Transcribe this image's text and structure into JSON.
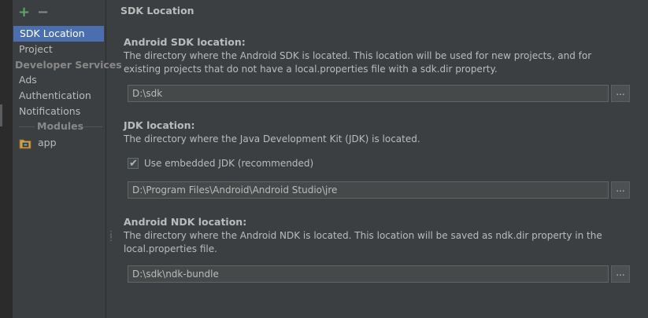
{
  "sidebar": {
    "add_glyph": "+",
    "remove_glyph": "−",
    "items": [
      {
        "label": "SDK Location",
        "selected": true
      },
      {
        "label": "Project"
      },
      {
        "label": "Developer Services",
        "header": true
      },
      {
        "label": "Ads"
      },
      {
        "label": "Authentication"
      },
      {
        "label": "Notifications"
      }
    ],
    "modules_header": "Modules",
    "modules": [
      {
        "label": "app",
        "icon": "module-folder-icon"
      }
    ]
  },
  "main": {
    "title": "SDK Location",
    "android_sdk": {
      "heading": "Android SDK location:",
      "description": "The directory where the Android SDK is located. This location will be used for new projects, and for existing projects that do not have a local.properties file with a sdk.dir property.",
      "value": "D:\\sdk",
      "browse": "..."
    },
    "jdk": {
      "heading": "JDK location:",
      "description": "The directory where the Java Development Kit (JDK) is located.",
      "embedded_label": "Use embedded JDK (recommended)",
      "embedded_checked": true,
      "value": "D:\\Program Files\\Android\\Android Studio\\jre",
      "browse": "..."
    },
    "ndk": {
      "heading": "Android NDK location:",
      "description": "The directory where the Android NDK is located. This location will be saved as ndk.dir property in the local.properties file.",
      "value": "D:\\sdk\\ndk-bundle",
      "browse": "..."
    }
  },
  "colors": {
    "background": "#3c3f41",
    "selection": "#4b6eaf",
    "add": "#59a869",
    "field": "#45494a"
  }
}
